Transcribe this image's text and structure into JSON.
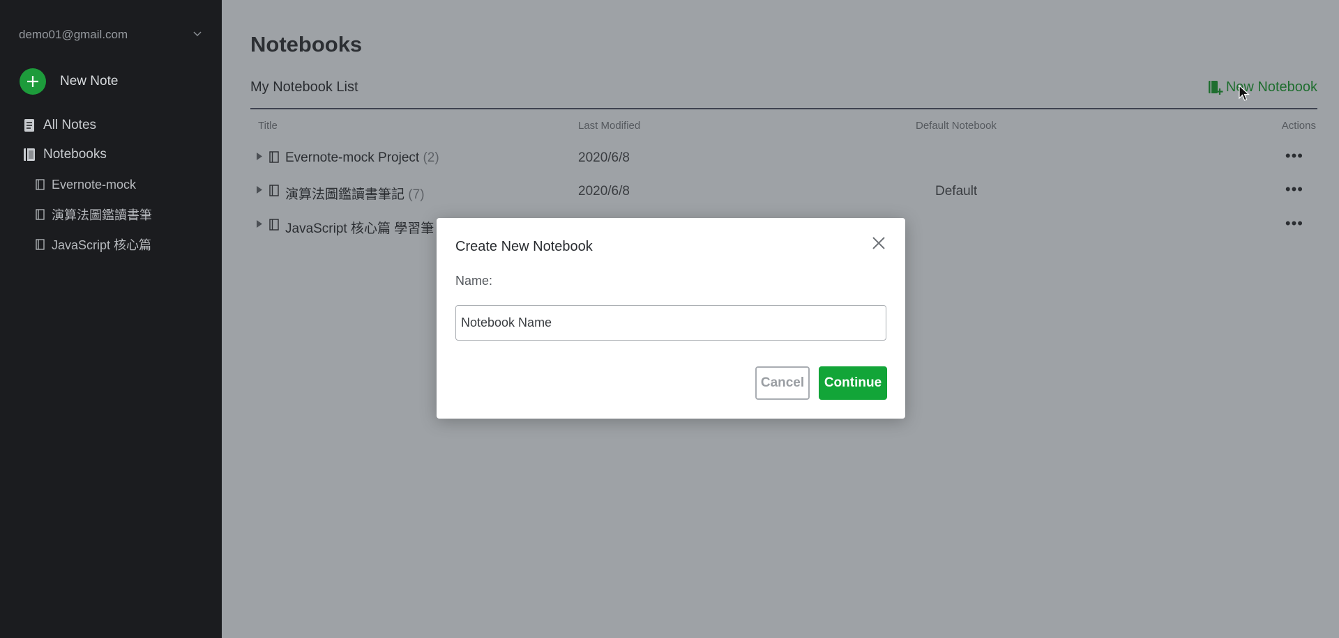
{
  "sidebar": {
    "account_email": "demo01@gmail.com",
    "new_note_label": "New Note",
    "all_notes_label": "All Notes",
    "notebooks_label": "Notebooks",
    "notebook_items": [
      "Evernote-mock",
      "演算法圖鑑讀書筆",
      "JavaScript 核心篇"
    ]
  },
  "main": {
    "page_title": "Notebooks",
    "list_title": "My Notebook List",
    "new_notebook_label": "New Notebook",
    "columns": {
      "title": "Title",
      "last_modified": "Last Modified",
      "default_notebook": "Default Notebook",
      "actions": "Actions"
    },
    "rows": [
      {
        "title": "Evernote-mock Project",
        "count": "(2)",
        "modified": "2020/6/8",
        "default": ""
      },
      {
        "title": "演算法圖鑑讀書筆記",
        "count": "(7)",
        "modified": "2020/6/8",
        "default": "Default"
      },
      {
        "title": "JavaScript 核心篇 學習筆",
        "count": "",
        "modified": "",
        "default": ""
      }
    ],
    "actions_glyph": "•••"
  },
  "modal": {
    "title": "Create New Notebook",
    "name_label": "Name:",
    "input_placeholder": "Notebook Name",
    "input_value": "",
    "cancel_label": "Cancel",
    "continue_label": "Continue"
  },
  "colors": {
    "sidebar_bg": "#1b1c1f",
    "overlay_bg": "#9ea2a6",
    "accent_green": "#12a538",
    "new_note_green": "#1d9b3b",
    "link_green": "#1f6e2f"
  },
  "icons": {
    "new_note": "plus-circle-icon",
    "all_notes": "note-icon",
    "notebooks": "notebook-icon",
    "notebook_item": "notebook-outline-icon",
    "new_notebook": "notebook-plus-icon",
    "close": "close-icon",
    "expand": "caret-right-icon",
    "actions": "more-horizontal-icon"
  }
}
